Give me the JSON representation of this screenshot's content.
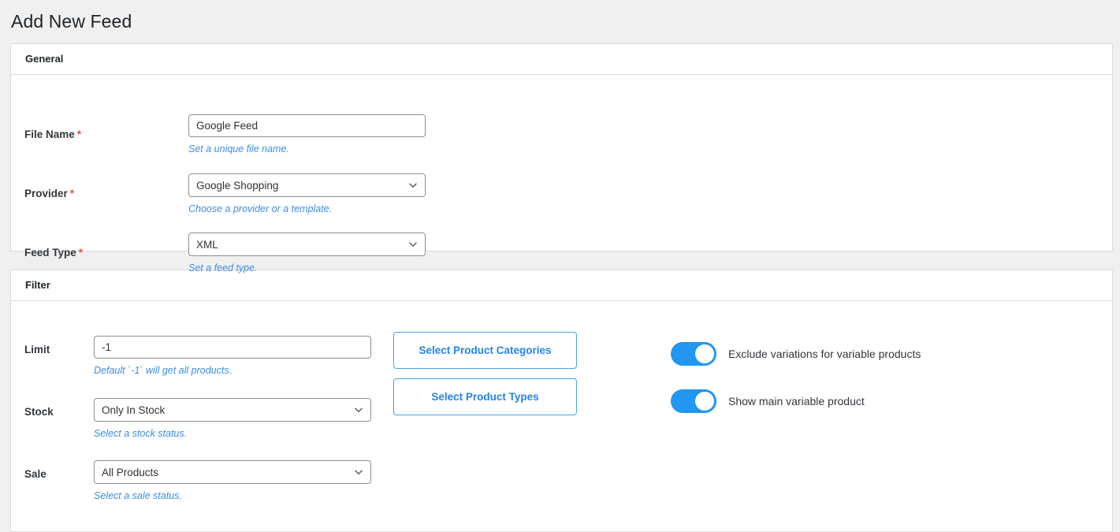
{
  "page": {
    "title": "Add New Feed"
  },
  "general": {
    "header": "General",
    "fields": [
      {
        "label": "File Name",
        "required": "*",
        "type": "text",
        "value": "Google Feed",
        "placeholder": "",
        "help": "Set a unique file name."
      },
      {
        "label": "Provider",
        "required": "*",
        "type": "select",
        "value": "Google Shopping",
        "help": "Choose a provider or a template."
      },
      {
        "label": "Feed Type",
        "required": "*",
        "type": "select",
        "value": "XML",
        "help": "Set a feed type."
      }
    ]
  },
  "filter": {
    "header": "Filter",
    "fields": [
      {
        "label": "Limit",
        "type": "text",
        "value": "-1",
        "placeholder": "",
        "help": "Default `-1` will get all products."
      },
      {
        "label": "Stock",
        "type": "select",
        "value": "Only In Stock",
        "help": "Select a stock status."
      },
      {
        "label": "Sale",
        "type": "select",
        "value": "All Products",
        "help": "Select a sale status."
      }
    ],
    "buttons": [
      {
        "label": "Select Product Categories"
      },
      {
        "label": "Select Product Types"
      }
    ],
    "toggles": [
      {
        "label": "Exclude variations for variable products",
        "on": true
      },
      {
        "label": "Show main variable product",
        "on": true
      }
    ]
  },
  "colors": {
    "page_background": "#f0f0f1",
    "panel_background": "#ffffff",
    "panel_border": "#dcdcde",
    "text": "#1d2327",
    "label": "#32373c",
    "help_text": "#3e8ce4",
    "required_asterisk": "#e2514a",
    "input_border": "#8c8f94",
    "accent_blue": "#2196f3",
    "button_border": "#46a2f1",
    "button_text": "#2583e6"
  },
  "icons": {
    "chevron_down": "chevron-down-icon"
  }
}
